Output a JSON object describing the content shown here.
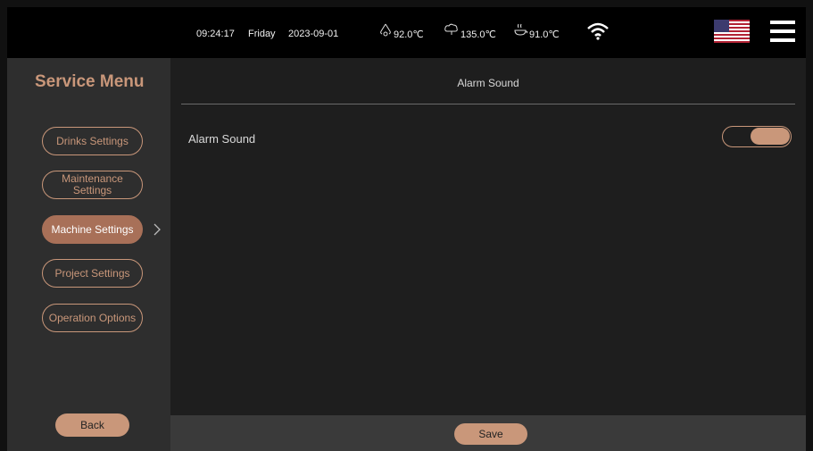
{
  "status_bar": {
    "time": "09:24:17",
    "day": "Friday",
    "date": "2023-09-01",
    "water_temp": "92.0℃",
    "steam_temp": "135.0℃",
    "cup_temp": "91.0℃",
    "icons": [
      "water-drop-icon",
      "steam-cloud-icon",
      "cup-icon",
      "wifi-icon",
      "us-flag-icon",
      "hamburger-menu-icon"
    ]
  },
  "sidebar": {
    "title": "Service Menu",
    "items": [
      {
        "label": "Drinks Settings",
        "active": false
      },
      {
        "label": "Maintenance Settings",
        "active": false
      },
      {
        "label": "Machine Settings",
        "active": true
      },
      {
        "label": "Project Settings",
        "active": false
      },
      {
        "label": "Operation Options",
        "active": false
      }
    ],
    "back_label": "Back"
  },
  "content": {
    "heading": "Alarm Sound",
    "settings": [
      {
        "label": "Alarm Sound",
        "enabled": true
      }
    ]
  },
  "footer": {
    "save_label": "Save"
  },
  "colors": {
    "accent": "#c9977a",
    "active": "#a87058",
    "topbar": "#000000",
    "sidebar": "#2e2e2e",
    "content": "#1e1e1e",
    "footer": "#3a3a3a"
  }
}
